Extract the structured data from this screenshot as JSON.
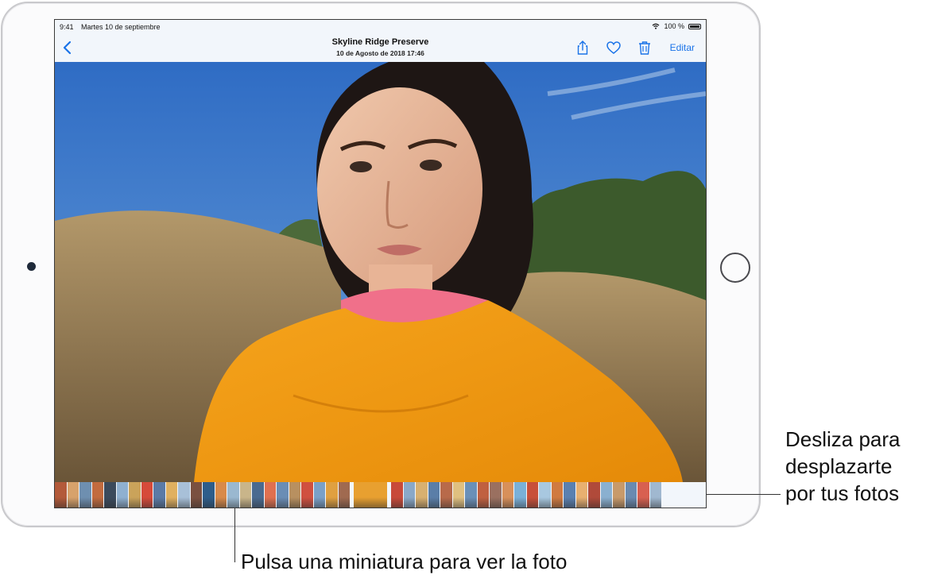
{
  "status_bar": {
    "time": "9:41",
    "date": "Martes 10 de septiembre",
    "battery": "100 %",
    "wifi_icon": "wifi-icon",
    "battery_icon": "battery-icon"
  },
  "nav": {
    "title": "Skyline Ridge Preserve",
    "subtitle": "10 de Agosto de 2018 17:46",
    "back_icon": "chevron-left-icon",
    "share_icon": "share-icon",
    "favorite_icon": "heart-icon",
    "delete_icon": "trash-icon",
    "edit_label": "Editar"
  },
  "photo": {
    "subject": "portrait-photo"
  },
  "filmstrip": {
    "count_before": 24,
    "count_after": 22,
    "colors": [
      "#b35a3a",
      "#d7a26b",
      "#6e8fb0",
      "#c26b3f",
      "#3b4a5c",
      "#8fb0d0",
      "#caa35a",
      "#d64a3a",
      "#5b7aa6",
      "#e0b060",
      "#a8c0d8",
      "#7a5040",
      "#2e5d8a",
      "#d88a4a",
      "#9ab8d0",
      "#c9b58a",
      "#4a6a90",
      "#e07050",
      "#6a8db5",
      "#b89060",
      "#d05040",
      "#7aa0c8",
      "#e0a040",
      "#a06a50",
      "#c84a3a",
      "#8aa8c8",
      "#d8b070",
      "#5a7ea8",
      "#b86a4a",
      "#e0c080",
      "#6a90b8",
      "#c06040",
      "#9a7060",
      "#d8905a",
      "#7ab0d8",
      "#c8503a",
      "#a8c8e0",
      "#d07a40",
      "#5a80b0",
      "#e8b070",
      "#b04a3a",
      "#8ab0d0",
      "#c89a6a",
      "#6a8ab0",
      "#d86050",
      "#a0b8d0"
    ],
    "selected_color": "#e8a030"
  },
  "callouts": {
    "swipe": [
      "Desliza para",
      "desplazarte",
      "por tus fotos"
    ],
    "tap": "Pulsa una miniatura para ver la foto"
  }
}
